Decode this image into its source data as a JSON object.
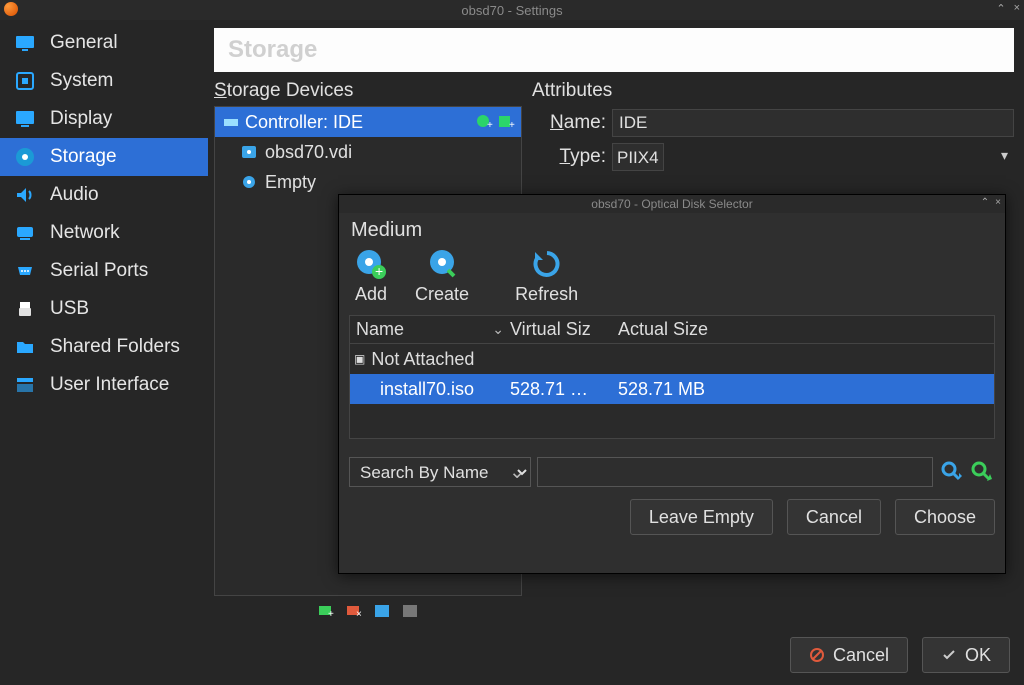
{
  "window": {
    "title": "obsd70 - Settings"
  },
  "page": {
    "title": "Storage"
  },
  "sidebar": {
    "items": [
      {
        "label": "General"
      },
      {
        "label": "System"
      },
      {
        "label": "Display"
      },
      {
        "label": "Storage"
      },
      {
        "label": "Audio"
      },
      {
        "label": "Network"
      },
      {
        "label": "Serial Ports"
      },
      {
        "label": "USB"
      },
      {
        "label": "Shared Folders"
      },
      {
        "label": "User Interface"
      }
    ],
    "selected_index": 3
  },
  "storage": {
    "devices_title": "Storage Devices",
    "attributes_title": "Attributes",
    "controller_label": "Controller: IDE",
    "disks": [
      {
        "label": "obsd70.vdi",
        "kind": "hdd"
      },
      {
        "label": "Empty",
        "kind": "optical"
      }
    ],
    "attr_name_label": "Name:",
    "attr_name_value": "IDE",
    "attr_type_label": "Type:",
    "attr_type_value": "PIIX4"
  },
  "modal": {
    "title": "obsd70 - Optical Disk Selector",
    "section_label": "Medium",
    "toolbar": {
      "add": "Add",
      "create": "Create",
      "refresh": "Refresh"
    },
    "columns": {
      "name": "Name",
      "virtual": "Virtual Siz",
      "actual": "Actual Size"
    },
    "group_label": "Not Attached",
    "rows": [
      {
        "name": "install70.iso",
        "virtual": "528.71 …",
        "actual": "528.71 MB"
      }
    ],
    "search_mode": "Search By Name",
    "buttons": {
      "leave_empty": "Leave Empty",
      "cancel": "Cancel",
      "choose": "Choose"
    }
  },
  "footer": {
    "cancel": "Cancel",
    "ok": "OK"
  }
}
